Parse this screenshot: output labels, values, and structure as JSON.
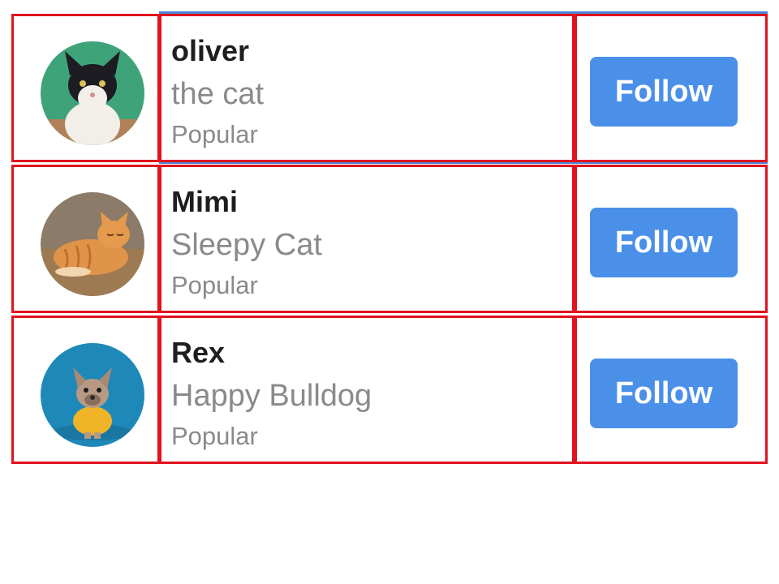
{
  "users": [
    {
      "name": "oliver",
      "subtitle": "the cat",
      "tag": "Popular",
      "button_label": "Follow",
      "avatar": "tuxedo-cat-photo",
      "avatar_bg": "#3fa37a"
    },
    {
      "name": "Mimi",
      "subtitle": "Sleepy Cat",
      "tag": "Popular",
      "button_label": "Follow",
      "avatar": "orange-cat-photo",
      "avatar_bg": "#7a6a58"
    },
    {
      "name": "Rex",
      "subtitle": "Happy Bulldog",
      "tag": "Popular",
      "button_label": "Follow",
      "avatar": "bulldog-photo",
      "avatar_bg": "#1e88b8"
    }
  ],
  "colors": {
    "accent": "#4a90e8",
    "outline": "#e0131f",
    "divider": "#4a86d8",
    "name_text": "#1e1e1e",
    "secondary_text": "#8a8a8a"
  }
}
